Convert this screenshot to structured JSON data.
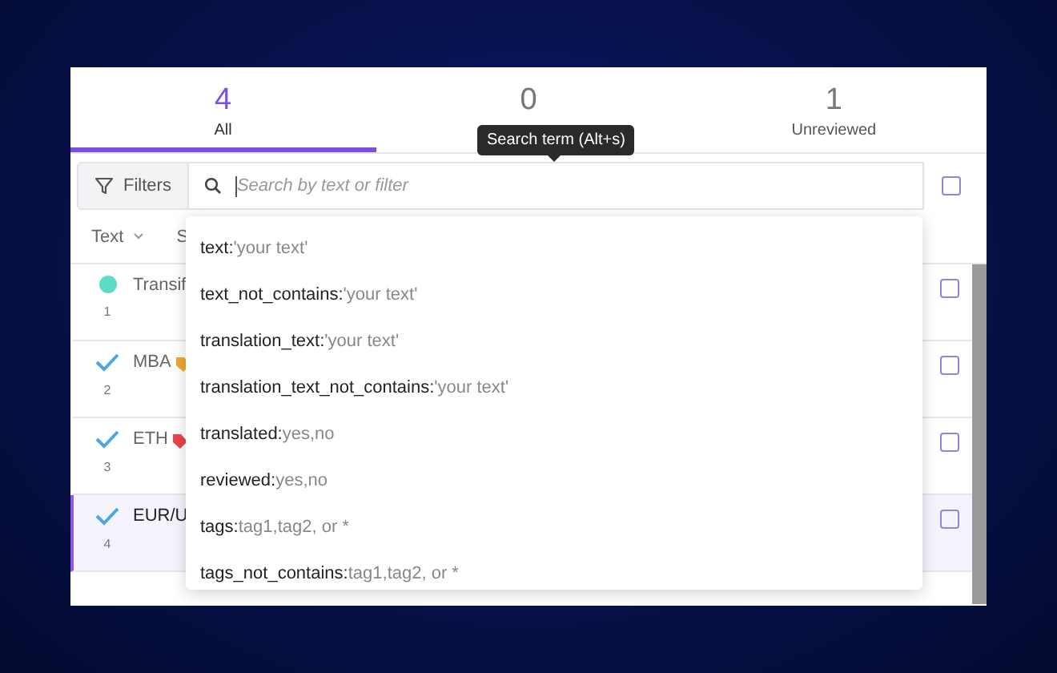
{
  "tabs": [
    {
      "count": "4",
      "label": "All",
      "selected": true
    },
    {
      "count": "0",
      "selected": false
    },
    {
      "count": "1",
      "label": "Unreviewed",
      "selected": false
    }
  ],
  "tooltip": "Search term (Alt+s)",
  "filters_button": "Filters",
  "search": {
    "placeholder": "Search by text or filter"
  },
  "select_all": {
    "checked": false
  },
  "columns": [
    {
      "label": "Text"
    },
    {
      "label": "S"
    }
  ],
  "rows": [
    {
      "kind": "dot",
      "text": "Transif",
      "number": "1",
      "selected": false,
      "checked": false
    },
    {
      "kind": "check",
      "text": "MBA",
      "color": "#f0a830",
      "number": "2",
      "selected": false,
      "checked": false
    },
    {
      "kind": "check",
      "text": "ETH",
      "color": "#e8464e",
      "number": "3",
      "selected": false,
      "checked": false
    },
    {
      "kind": "check",
      "text": "EUR/U",
      "number": "4",
      "selected": true,
      "checked": false
    }
  ],
  "suggestions": [
    {
      "key": "text:",
      "hint": "'your text'"
    },
    {
      "key": "text_not_contains:",
      "hint": "'your text'"
    },
    {
      "key": "translation_text:",
      "hint": "'your text'"
    },
    {
      "key": "translation_text_not_contains:",
      "hint": "'your text'"
    },
    {
      "key": "translated:",
      "hint": "yes,no"
    },
    {
      "key": "reviewed:",
      "hint": "yes,no"
    },
    {
      "key": "tags:",
      "hint": "tag1,tag2, or *"
    },
    {
      "key": "tags_not_contains:",
      "hint": "tag1,tag2, or *"
    }
  ]
}
